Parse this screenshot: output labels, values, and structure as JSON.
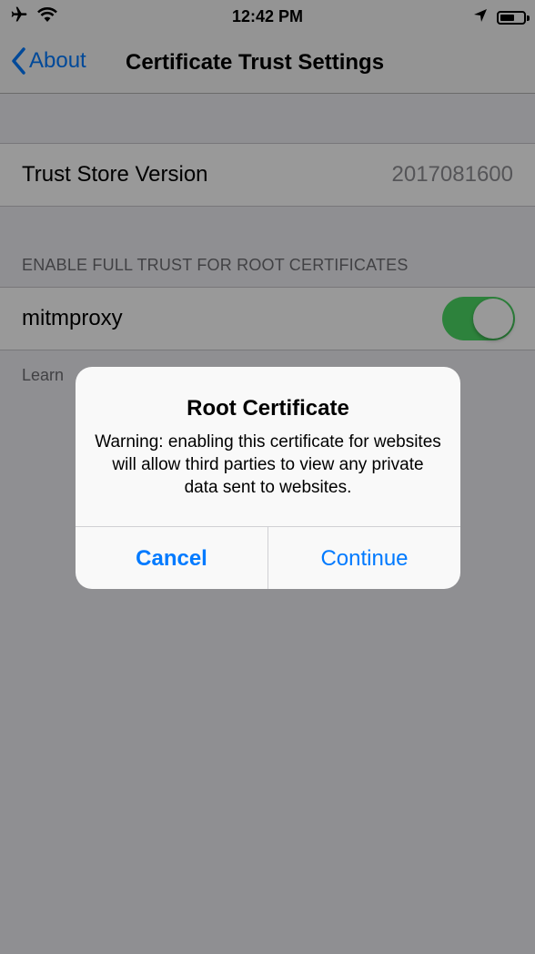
{
  "status_bar": {
    "time": "12:42 PM",
    "left_icons": [
      "airplane-icon",
      "wifi-icon"
    ],
    "right_icons": [
      "location-arrow-icon",
      "battery-icon"
    ],
    "battery_level": 0.55
  },
  "nav": {
    "back_label": "About",
    "title": "Certificate Trust Settings"
  },
  "trust_store": {
    "label": "Trust Store Version",
    "value": "2017081600"
  },
  "section": {
    "header": "ENABLE FULL TRUST FOR ROOT CERTIFICATES",
    "items": [
      {
        "label": "mitmproxy",
        "enabled": true
      }
    ],
    "footer_visible": "Learn"
  },
  "alert": {
    "title": "Root Certificate",
    "message": "Warning: enabling this certificate for websites will allow third parties to view any private data sent to websites.",
    "cancel_label": "Cancel",
    "continue_label": "Continue"
  },
  "colors": {
    "accent": "#007aff",
    "toggle_on": "#4cd964",
    "background": "#efeff4"
  }
}
